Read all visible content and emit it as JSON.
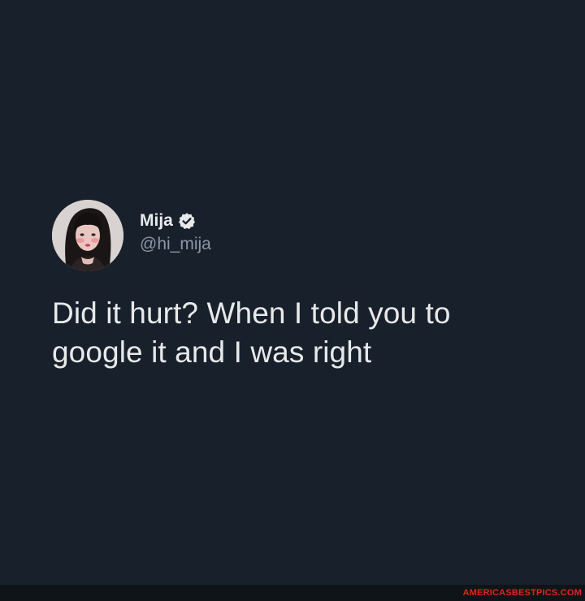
{
  "tweet": {
    "author": {
      "display_name": "Mija",
      "handle": "@hi_mija",
      "verified": true,
      "avatar_icon": "profile-photo"
    },
    "text": "Did it hurt? When I told you to google it and I was right"
  },
  "watermark": {
    "text": "AMERICASBESTPICS.COM"
  },
  "colors": {
    "background": "#18212b",
    "text_primary": "#e7e9ea",
    "text_secondary": "#8b98a5",
    "watermark": "#e1251b"
  }
}
